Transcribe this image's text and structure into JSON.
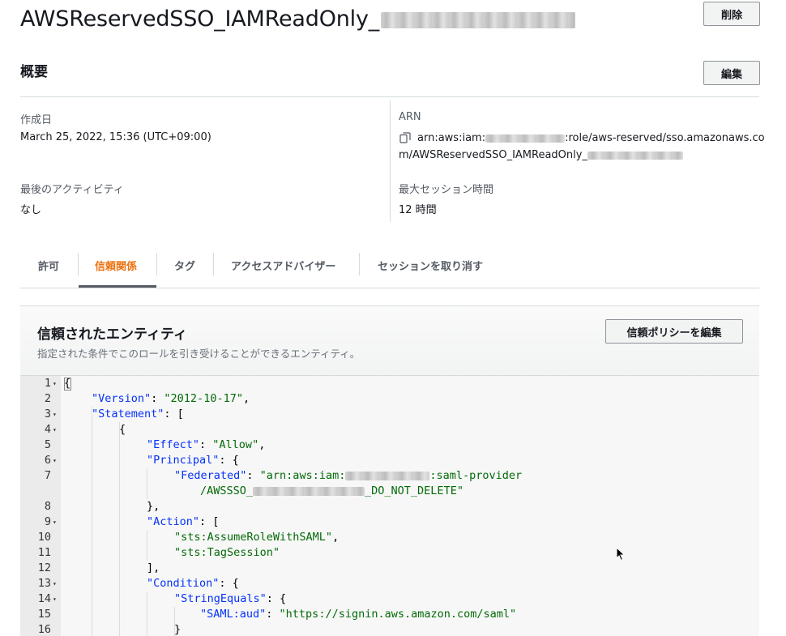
{
  "header": {
    "title_prefix": "AWSReservedSSO_IAMReadOnly_",
    "delete_button": "削除"
  },
  "summary": {
    "title": "概要",
    "edit_button": "編集",
    "created_label": "作成日",
    "created_value": "March 25, 2022, 15:36 (UTC+09:00)",
    "last_activity_label": "最後のアクティビティ",
    "last_activity_value": "なし",
    "arn_label": "ARN",
    "arn_part1": "arn:aws:iam:",
    "arn_part2": ":role/aws-reserved/sso.amazonaws.co",
    "arn_part3": "m/AWSReservedSSO_IAMReadOnly_",
    "max_session_label": "最大セッション時間",
    "max_session_value": "12 時間"
  },
  "tabs": [
    {
      "label": "許可"
    },
    {
      "label": "信頼関係"
    },
    {
      "label": "タグ"
    },
    {
      "label": "アクセスアドバイザー"
    },
    {
      "label": "セッションを取り消す"
    }
  ],
  "active_tab": "信頼関係",
  "trusted": {
    "title": "信頼されたエンティティ",
    "description": "指定された条件でこのロールを引き受けることができるエンティティ。",
    "edit_button": "信頼ポリシーを編集"
  },
  "editor": {
    "lines": [
      {
        "n": "1",
        "fold": true
      },
      {
        "n": "2",
        "fold": false
      },
      {
        "n": "3",
        "fold": true
      },
      {
        "n": "4",
        "fold": true
      },
      {
        "n": "5",
        "fold": false
      },
      {
        "n": "6",
        "fold": true
      },
      {
        "n": "7",
        "fold": false
      },
      {
        "n": "8",
        "fold": false
      },
      {
        "n": "9",
        "fold": true
      },
      {
        "n": "10",
        "fold": false
      },
      {
        "n": "11",
        "fold": false
      },
      {
        "n": "12",
        "fold": false
      },
      {
        "n": "13",
        "fold": true
      },
      {
        "n": "14",
        "fold": true
      },
      {
        "n": "15",
        "fold": false
      },
      {
        "n": "16",
        "fold": false
      }
    ],
    "tokens": {
      "open_brace": "{",
      "version_key": "\"Version\"",
      "version_val": "\"2012-10-17\"",
      "statement_key": "\"Statement\"",
      "effect_key": "\"Effect\"",
      "effect_val": "\"Allow\"",
      "principal_key": "\"Principal\"",
      "federated_key": "\"Federated\"",
      "federated_val_1": "\"arn:aws:iam:",
      "federated_val_2": ":saml-provider",
      "federated_val_3": "/AWSSSO_",
      "federated_val_4": "_DO_NOT_DELETE\"",
      "action_key": "\"Action\"",
      "action_1": "\"sts:AssumeRoleWithSAML\"",
      "action_2": "\"sts:TagSession\"",
      "condition_key": "\"Condition\"",
      "stringequals_key": "\"StringEquals\"",
      "saml_aud_key": "\"SAML:aud\"",
      "saml_aud_val": "\"https://signin.aws.amazon.com/saml\""
    }
  }
}
